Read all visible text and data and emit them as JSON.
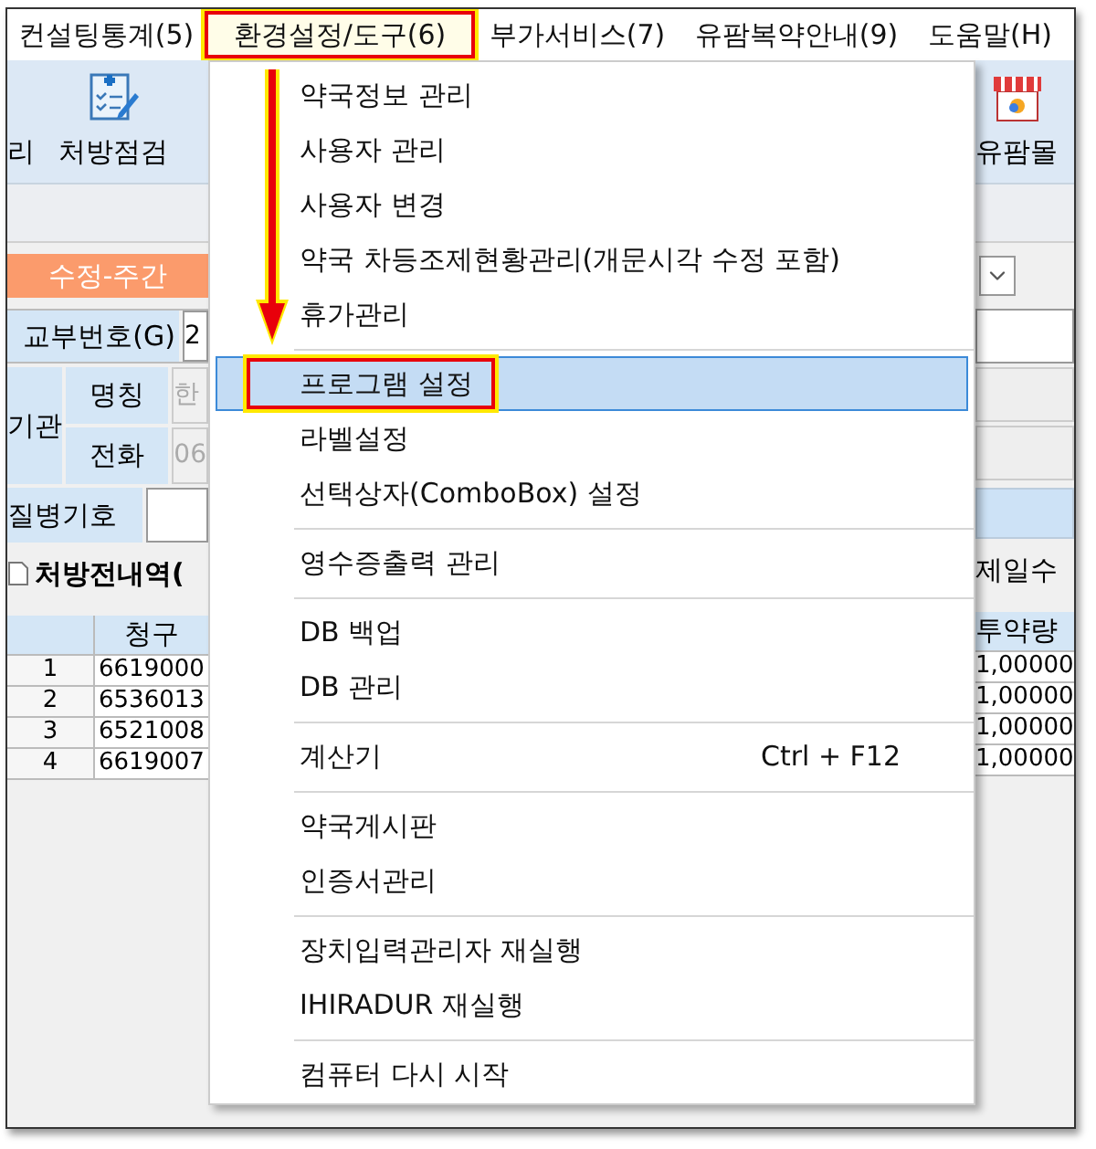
{
  "menu_bar": [
    {
      "label": "컨설팅통계(5)",
      "selected": false,
      "annotated": false
    },
    {
      "label": "환경설정/도구(6)",
      "selected": true,
      "annotated": true
    },
    {
      "label": "부가서비스(7)",
      "selected": false,
      "annotated": false
    },
    {
      "label": "유팜복약안내(9)",
      "selected": false,
      "annotated": false
    },
    {
      "label": "도움말(H)",
      "selected": false,
      "annotated": false
    }
  ],
  "toolbar": {
    "left_cut_label": "리",
    "check_button": "처방점검",
    "mall_button": "유팜몰"
  },
  "mode_badge": "수정-주간",
  "form": {
    "dispense_label": "교부번호(G)",
    "dispense_value": "2",
    "institution_label": "기관",
    "name_label": "명칭",
    "name_value": "한",
    "phone_label": "전화",
    "phone_value": "06",
    "disease_label": "질병기호"
  },
  "history": {
    "title": "처방전내역(",
    "right_label": "제일수",
    "columns": [
      "청구",
      "투약량"
    ],
    "rows": [
      {
        "no": "1",
        "code": "6619000",
        "dose": "1,00000"
      },
      {
        "no": "2",
        "code": "6536013",
        "dose": "1,00000"
      },
      {
        "no": "3",
        "code": "6521008",
        "dose": "1,00000"
      },
      {
        "no": "4",
        "code": "6619007",
        "dose": "1,00000"
      }
    ]
  },
  "dropdown": {
    "items": [
      {
        "kind": "item",
        "label": "약국정보 관리",
        "selected": false,
        "annotated": false
      },
      {
        "kind": "item",
        "label": "사용자 관리",
        "selected": false,
        "annotated": false
      },
      {
        "kind": "item",
        "label": "사용자 변경",
        "selected": false,
        "annotated": false
      },
      {
        "kind": "item",
        "label": "약국 차등조제현황관리(개문시각 수정 포함)",
        "selected": false,
        "annotated": false
      },
      {
        "kind": "item",
        "label": "휴가관리",
        "selected": false,
        "annotated": false
      },
      {
        "kind": "separator"
      },
      {
        "kind": "item",
        "label": "프로그램 설정",
        "selected": true,
        "annotated": true
      },
      {
        "kind": "item",
        "label": "라벨설정",
        "selected": false,
        "annotated": false
      },
      {
        "kind": "item",
        "label": "선택상자(ComboBox) 설정",
        "selected": false,
        "annotated": false
      },
      {
        "kind": "separator"
      },
      {
        "kind": "item",
        "label": "영수증출력 관리",
        "selected": false,
        "annotated": false
      },
      {
        "kind": "separator"
      },
      {
        "kind": "item",
        "label": "DB 백업",
        "selected": false,
        "annotated": false
      },
      {
        "kind": "item",
        "label": "DB 관리",
        "selected": false,
        "annotated": false
      },
      {
        "kind": "separator"
      },
      {
        "kind": "item",
        "label": "계산기",
        "shortcut": "Ctrl + F12",
        "selected": false,
        "annotated": false
      },
      {
        "kind": "separator"
      },
      {
        "kind": "item",
        "label": "약국게시판",
        "selected": false,
        "annotated": false
      },
      {
        "kind": "item",
        "label": "인증서관리",
        "selected": false,
        "annotated": false
      },
      {
        "kind": "separator"
      },
      {
        "kind": "item",
        "label": "장치입력관리자 재실행",
        "selected": false,
        "annotated": false
      },
      {
        "kind": "item",
        "label": "IHIRADUR 재실행",
        "selected": false,
        "annotated": false
      },
      {
        "kind": "separator"
      },
      {
        "kind": "item",
        "label": "컴퓨터 다시 시작",
        "selected": false,
        "annotated": false
      }
    ]
  }
}
